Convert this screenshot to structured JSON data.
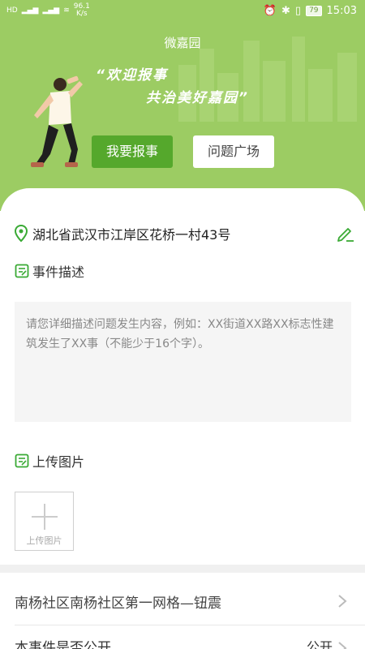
{
  "statusbar": {
    "left_icons": [
      "hd-icon",
      "signal-4g-icon",
      "signal-4g-icon",
      "wifi-icon"
    ],
    "network_speed_value": "96.1",
    "network_speed_unit": "K/s",
    "battery": "79",
    "time": "15:03"
  },
  "header": {
    "app_title": "微嘉园",
    "slogan_line1": "“欢迎报事",
    "slogan_line2": "共治美好嘉园”",
    "report_button": "我要报事",
    "square_button": "问题广场"
  },
  "form": {
    "address": "湖北省武汉市江岸区花桥一村43号",
    "description_title": "事件描述",
    "description_placeholder": "请您详细描述问题发生内容，例如：XX街道XX路XX标志性建筑发生了XX事（不能少于16个字）。",
    "upload_title": "上传图片",
    "upload_box_label": "上传图片",
    "community_row": "南杨社区南杨社区第一网格—钮震",
    "public_row_label": "本事件是否公开",
    "public_row_value": "公开"
  },
  "colors": {
    "header_green": "#9ccc63",
    "accent_green": "#55a82c",
    "icon_green": "#3aaa35"
  }
}
